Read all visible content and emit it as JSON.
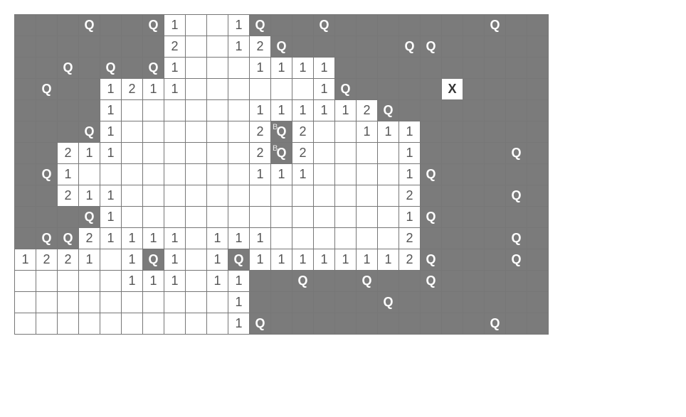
{
  "grid": {
    "cols": 25,
    "rows": 17,
    "cells": [
      [
        "c",
        "c",
        "c",
        "Q",
        "c",
        "c",
        "Q",
        "o1",
        "o",
        "o",
        "o1",
        "Q",
        "c",
        "c",
        "Q",
        "c",
        "c",
        "c",
        "c",
        "c",
        "c",
        "c",
        "Q",
        "c",
        "c"
      ],
      [
        "c",
        "c",
        "c",
        "c",
        "c",
        "c",
        "c",
        "o2",
        "o",
        "o",
        "o1",
        "o2",
        "Q",
        "c",
        "c",
        "c",
        "c",
        "c",
        "Q",
        "Q",
        "c",
        "c",
        "c",
        "c",
        "c"
      ],
      [
        "c",
        "c",
        "Q",
        "c",
        "Q",
        "c",
        "Q",
        "o1",
        "o",
        "o",
        "o",
        "o1",
        "o1",
        "o1",
        "o1",
        "c",
        "c",
        "c",
        "c",
        "c",
        "c",
        "c",
        "c",
        "c",
        "c"
      ],
      [
        "c",
        "Q",
        "c",
        "c",
        "o1",
        "o2",
        "o1",
        "o1",
        "o",
        "o",
        "o",
        "o",
        "o",
        "o",
        "o1",
        "Q",
        "c",
        "c",
        "c",
        "c",
        "X",
        "c",
        "c",
        "c",
        "c"
      ],
      [
        "c",
        "c",
        "c",
        "c",
        "o1",
        "o",
        "o",
        "o",
        "o",
        "o",
        "o",
        "o1",
        "o1",
        "o1",
        "o1",
        "o1",
        "o2",
        "Q",
        "c",
        "c",
        "c",
        "c",
        "c",
        "c",
        "c"
      ],
      [
        "c",
        "c",
        "c",
        "Q",
        "o1",
        "o",
        "o",
        "o",
        "o",
        "o",
        "o",
        "o2",
        "S",
        "o2",
        "o",
        "o",
        "o1",
        "o1",
        "o1",
        "c",
        "c",
        "c",
        "c",
        "c",
        "c"
      ],
      [
        "c",
        "c",
        "o2",
        "o1",
        "o1",
        "o",
        "o",
        "o",
        "o",
        "o",
        "o",
        "o2",
        "S",
        "o2",
        "o",
        "o",
        "o",
        "o",
        "o1",
        "c",
        "c",
        "c",
        "c",
        "Q",
        "c"
      ],
      [
        "c",
        "Q",
        "o1",
        "o",
        "o",
        "o",
        "o",
        "o",
        "o",
        "o",
        "o",
        "o1",
        "o1",
        "o1",
        "o",
        "o",
        "o",
        "o",
        "o1",
        "Q",
        "c",
        "c",
        "c",
        "c",
        "c"
      ],
      [
        "c",
        "c",
        "o2",
        "o1",
        "o1",
        "o",
        "o",
        "o",
        "o",
        "o",
        "o",
        "o",
        "o",
        "o",
        "o",
        "o",
        "o",
        "o",
        "o2",
        "c",
        "c",
        "c",
        "c",
        "Q",
        "c"
      ],
      [
        "c",
        "c",
        "c",
        "Q",
        "o1",
        "o",
        "o",
        "o",
        "o",
        "o",
        "o",
        "o",
        "o",
        "o",
        "o",
        "o",
        "o",
        "o",
        "o1",
        "Q",
        "c",
        "c",
        "c",
        "c",
        "c"
      ],
      [
        "c",
        "Q",
        "Q",
        "o2",
        "o1",
        "o1",
        "o1",
        "o1",
        "o",
        "o1",
        "o1",
        "o1",
        "o",
        "o",
        "o",
        "o",
        "o",
        "o",
        "o2",
        "c",
        "c",
        "c",
        "c",
        "Q",
        "c"
      ],
      [
        "o1",
        "o2",
        "o2",
        "o1",
        "o",
        "o1",
        "Q",
        "o1",
        "o",
        "o1",
        "Q",
        "o1",
        "o1",
        "o1",
        "o1",
        "o1",
        "o1",
        "o1",
        "o2",
        "Q",
        "c",
        "c",
        "c",
        "Q",
        "c"
      ],
      [
        "o",
        "o",
        "o",
        "o",
        "o",
        "o1",
        "o1",
        "o1",
        "o",
        "o1",
        "o1",
        "c",
        "c",
        "Q",
        "c",
        "c",
        "Q",
        "c",
        "c",
        "Q",
        "c",
        "c",
        "c",
        "c",
        "c"
      ],
      [
        "o",
        "o",
        "o",
        "o",
        "o",
        "o",
        "o",
        "o",
        "o",
        "o",
        "o1",
        "c",
        "c",
        "c",
        "c",
        "c",
        "c",
        "Q",
        "c",
        "c",
        "c",
        "c",
        "c",
        "c",
        "c"
      ],
      [
        "o",
        "o",
        "o",
        "o",
        "o",
        "o",
        "o",
        "o",
        "o",
        "o",
        "o1",
        "Q",
        "c",
        "c",
        "c",
        "c",
        "c",
        "c",
        "c",
        "c",
        "c",
        "c",
        "Q",
        "c",
        "c"
      ],
      [
        "b",
        "b",
        "b",
        "b",
        "b",
        "b",
        "b",
        "b",
        "b",
        "b",
        "b",
        "b",
        "b",
        "b",
        "b",
        "b",
        "b",
        "b",
        "b",
        "b",
        "b",
        "b",
        "b",
        "b",
        "b"
      ],
      [
        "b",
        "b",
        "b",
        "b",
        "b",
        "b",
        "b",
        "b",
        "b",
        "b",
        "b",
        "b",
        "b",
        "b",
        "b",
        "b",
        "b",
        "b",
        "b",
        "b",
        "b",
        "b",
        "b",
        "b",
        "b"
      ]
    ]
  },
  "legend": {
    "c": "covered",
    "Q": "covered-question",
    "o": "open-blank",
    "o1": "open-1",
    "o2": "open-2",
    "X": "x-mark",
    "S": "stacked-BQ",
    "b": "blank-white-row"
  },
  "glyphs": {
    "Q": "Q",
    "1": "1",
    "2": "2",
    "X": "X",
    "stack_under": "B",
    "stack_over": "Q"
  }
}
